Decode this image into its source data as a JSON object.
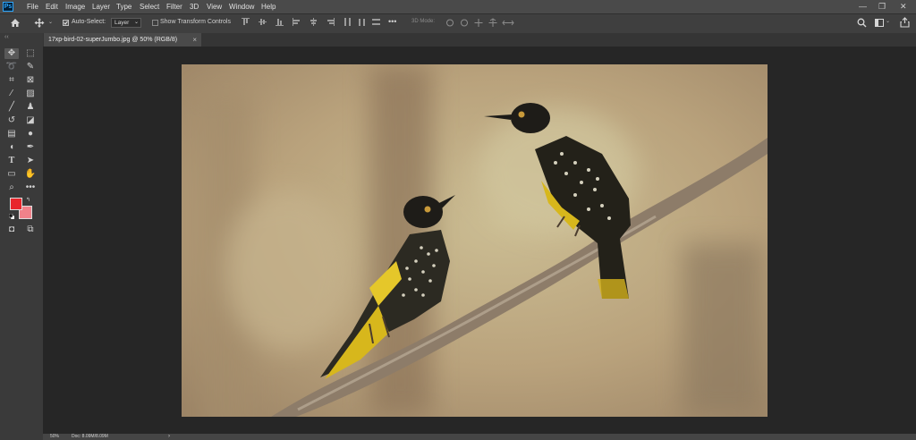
{
  "app": {
    "logo": "Ps"
  },
  "menu": [
    "File",
    "Edit",
    "Image",
    "Layer",
    "Type",
    "Select",
    "Filter",
    "3D",
    "View",
    "Window",
    "Help"
  ],
  "window_controls": {
    "minimize": "—",
    "restore": "❐",
    "close": "✕"
  },
  "options_bar": {
    "auto_select_label": "Auto-Select:",
    "layer_dropdown_value": "Layer",
    "show_transform_label": "Show Transform Controls",
    "more_label": "•••",
    "mode_3d_label": "3D Mode:"
  },
  "document_tab": {
    "title": "17xp-bird-02-superJumbo.jpg @ 50% (RGB/8)",
    "close": "×"
  },
  "colors": {
    "foreground": "#e8262c",
    "background": "#f0828a",
    "ui_dark": "#262626",
    "ui_panel": "#3a3a3a"
  },
  "status_bar": {
    "zoom": "50%",
    "doc": "Doc: 8.09M/8.09M",
    "arrow": "›"
  },
  "tools": [
    "move-tool",
    "marquee-tool",
    "lasso-tool",
    "quick-selection-tool",
    "crop-tool",
    "frame-tool",
    "eyedropper-tool",
    "healing-brush-tool",
    "brush-tool",
    "stamp-tool",
    "history-brush-tool",
    "eraser-tool",
    "gradient-tool",
    "blur-tool",
    "dodge-tool",
    "pen-tool",
    "type-tool",
    "path-selection-tool",
    "rectangle-tool",
    "hand-tool",
    "zoom-tool",
    "more-tools"
  ],
  "icons": {
    "home": "home-icon",
    "search": "search-icon",
    "workspace": "workspace-icon",
    "share": "share-icon"
  }
}
